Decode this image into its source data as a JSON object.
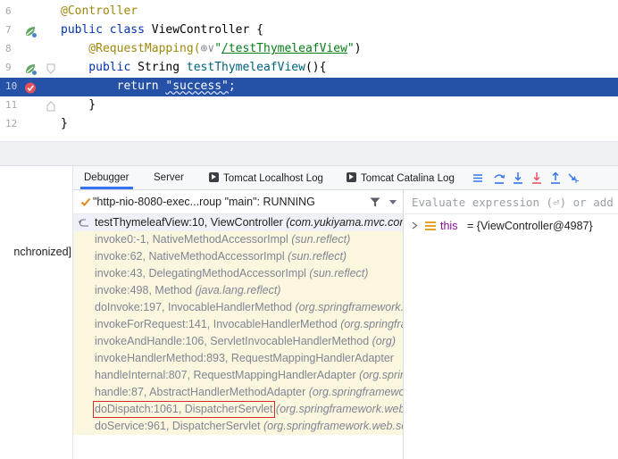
{
  "editor": {
    "lines": [
      {
        "num": "6",
        "parts": [
          {
            "t": "@Controller",
            "c": "ann"
          }
        ]
      },
      {
        "num": "7",
        "parts": [
          {
            "t": "public class ",
            "c": "kw"
          },
          {
            "t": "ViewController {",
            "c": ""
          }
        ]
      },
      {
        "num": "8",
        "parts": [
          {
            "t": "    @RequestMapping(",
            "c": "ann"
          },
          {
            "t": "⊕∨",
            "c": "ann"
          },
          {
            "t": "\"",
            "c": "str"
          },
          {
            "t": "/testThymeleafView",
            "c": "link"
          },
          {
            "t": "\"",
            "c": "str"
          },
          {
            "t": ")",
            "c": ""
          }
        ]
      },
      {
        "num": "9",
        "parts": [
          {
            "t": "    public ",
            "c": "kw"
          },
          {
            "t": "String ",
            "c": ""
          },
          {
            "t": "testThymeleafView",
            "c": "fn"
          },
          {
            "t": "(){",
            "c": ""
          }
        ]
      },
      {
        "num": "10",
        "parts": [
          {
            "t": "        return ",
            "c": "kw"
          },
          {
            "t": "\"success\"",
            "c": "str"
          },
          {
            "t": ";",
            "c": ""
          }
        ]
      },
      {
        "num": "11",
        "parts": [
          {
            "t": "    }",
            "c": ""
          }
        ]
      },
      {
        "num": "12",
        "parts": [
          {
            "t": "}",
            "c": ""
          }
        ]
      }
    ]
  },
  "left_strip": {
    "sync_label": "nchronized]"
  },
  "tabs": {
    "debugger": "Debugger",
    "server": "Server",
    "tomcat_localhost_log": "Tomcat Localhost Log",
    "tomcat_catalina_log": "Tomcat Catalina Log"
  },
  "thread": {
    "label": "\"http-nio-8080-exec...roup \"main\": RUNNING"
  },
  "frames": [
    {
      "method": "testThymeleafView:10, ViewController",
      "pkg": "(com.yukiyama.mvc.controller)"
    },
    {
      "method": "invoke0:-1, NativeMethodAccessorImpl",
      "pkg": "(sun.reflect)"
    },
    {
      "method": "invoke:62, NativeMethodAccessorImpl",
      "pkg": "(sun.reflect)"
    },
    {
      "method": "invoke:43, DelegatingMethodAccessorImpl",
      "pkg": "(sun.reflect)"
    },
    {
      "method": "invoke:498, Method",
      "pkg": "(java.lang.reflect)"
    },
    {
      "method": "doInvoke:197, InvocableHandlerMethod",
      "pkg": "(org.springframework.web.method)"
    },
    {
      "method": "invokeForRequest:141, InvocableHandlerMethod",
      "pkg": "(org.springframework)"
    },
    {
      "method": "invokeAndHandle:106, ServletInvocableHandlerMethod",
      "pkg": "(org)"
    },
    {
      "method": "invokeHandlerMethod:893, RequestMappingHandlerAdapter",
      "pkg": ""
    },
    {
      "method": "handleInternal:807, RequestMappingHandlerAdapter",
      "pkg": "(org.springframework)"
    },
    {
      "method": "handle:87, AbstractHandlerMethodAdapter",
      "pkg": "(org.springframework)"
    },
    {
      "method": "doDispatch:1061, DispatcherServlet",
      "pkg": "(org.springframework.web.servlet)"
    },
    {
      "method": "doService:961, DispatcherServlet",
      "pkg": "(org.springframework.web.servlet)"
    }
  ],
  "variables": {
    "eval_placeholder": "Evaluate expression (⏎) or add a watch",
    "items": [
      {
        "name": "this",
        "value": "= {ViewController@4987}"
      }
    ]
  },
  "colors": {
    "highlight_line": "#2552a6",
    "selected_box": "#d42b2b",
    "tab_accent": "#3574f0"
  }
}
